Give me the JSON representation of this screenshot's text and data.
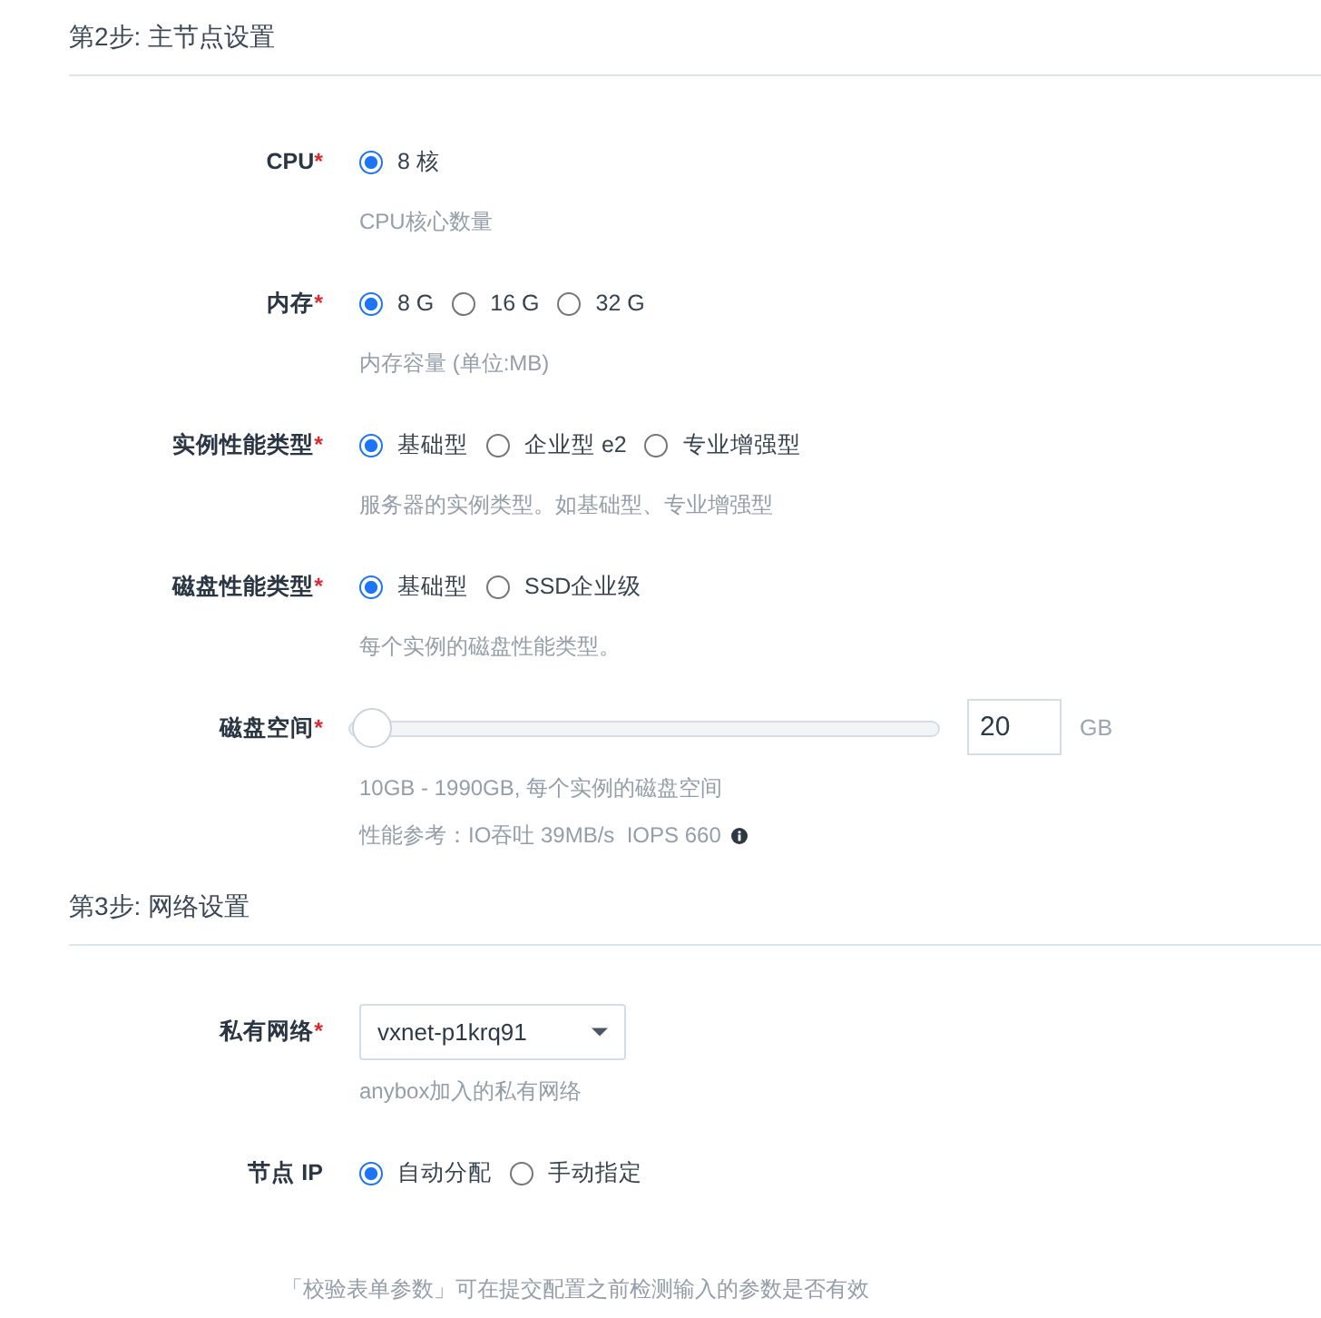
{
  "sections": [
    {
      "title": "第2步: 主节点设置",
      "fields": [
        {
          "kind": "radio",
          "label": "CPU",
          "required_mark": "*",
          "options": [
            {
              "label": "8 核",
              "selected": true
            }
          ],
          "hints": [
            {
              "text": "CPU核心数量"
            }
          ]
        },
        {
          "kind": "radio",
          "label": "内存",
          "required_mark": "*",
          "options": [
            {
              "label": "8 G",
              "selected": true
            },
            {
              "label": "16 G",
              "selected": false
            },
            {
              "label": "32 G",
              "selected": false
            }
          ],
          "hints": [
            {
              "text": "内存容量 (单位:MB)"
            }
          ]
        },
        {
          "kind": "radio",
          "label": "实例性能类型",
          "required_mark": "*",
          "options": [
            {
              "label": "基础型",
              "selected": true
            },
            {
              "label": "企业型 e2",
              "selected": false
            },
            {
              "label": "专业增强型",
              "selected": false
            }
          ],
          "hints": [
            {
              "text": "服务器的实例类型。如基础型、专业增强型"
            }
          ]
        },
        {
          "kind": "radio",
          "label": "磁盘性能类型",
          "required_mark": "*",
          "options": [
            {
              "label": "基础型",
              "selected": true
            },
            {
              "label": "SSD企业级",
              "selected": false
            }
          ],
          "hints": [
            {
              "text": "每个实例的磁盘性能类型。"
            }
          ]
        },
        {
          "kind": "slider",
          "label": "磁盘空间",
          "required_mark": "*",
          "level": 0.005,
          "value": "20",
          "unit": "GB",
          "hints": [
            {
              "text": "10GB - 1990GB, 每个实例的磁盘空间"
            },
            {
              "text": "性能参考：IO吞吐 39MB/s  IOPS 660",
              "info": true
            }
          ]
        }
      ]
    },
    {
      "title": "第3步: 网络设置",
      "fields": [
        {
          "kind": "select",
          "label": "私有网络",
          "required_mark": "*",
          "value": "vxnet-p1krq91",
          "hints": [
            {
              "text": "anybox加入的私有网络"
            }
          ]
        },
        {
          "kind": "radio",
          "label": "节点 IP",
          "options": [
            {
              "label": "自动分配",
              "selected": true
            },
            {
              "label": "手动指定",
              "selected": false
            }
          ]
        }
      ]
    }
  ],
  "footer_note": "「校验表单参数」可在提交配置之前检测输入的参数是否有效"
}
